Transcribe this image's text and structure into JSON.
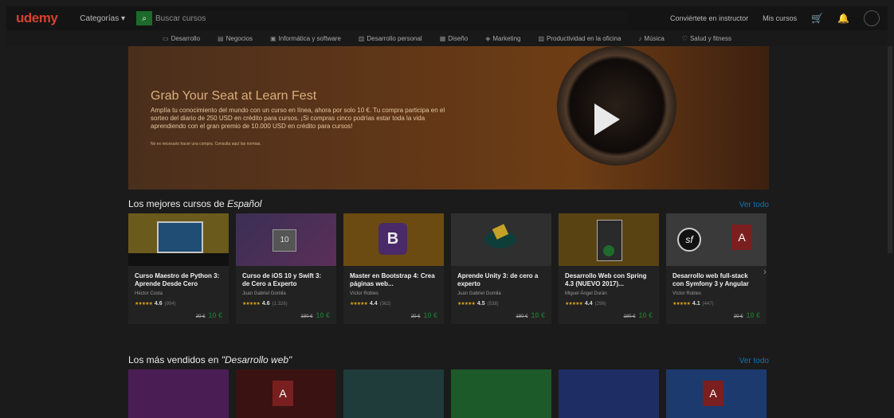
{
  "header": {
    "logo": "udemy",
    "categories_label": "Categorías ▾",
    "search_placeholder": "Buscar cursos",
    "links": [
      "Conviértete en instructor",
      "Mis cursos"
    ]
  },
  "nav": {
    "items": [
      {
        "label": "Desarrollo",
        "icon": "code-icon"
      },
      {
        "label": "Negocios",
        "icon": "briefcase-icon"
      },
      {
        "label": "Informática y software",
        "icon": "computer-icon"
      },
      {
        "label": "Desarrollo personal",
        "icon": "person-icon"
      },
      {
        "label": "Diseño",
        "icon": "pen-icon"
      },
      {
        "label": "Marketing",
        "icon": "megaphone-icon"
      },
      {
        "label": "Productividad en la oficina",
        "icon": "monitor-icon"
      },
      {
        "label": "Música",
        "icon": "music-icon"
      },
      {
        "label": "Salud y fitness",
        "icon": "heart-icon"
      }
    ]
  },
  "banner": {
    "title": "Grab Your Seat at Learn Fest",
    "text": "Amplía tu conocimiento del mundo con un curso en línea, ahora por solo 10 €. Tu compra participa en el sorteo del diario de 250 USD en crédito para cursos. ¡Si compras cinco podrías estar toda la vida aprendiendo con el gran premio de 10.000 USD en crédito para cursos!",
    "small": "No es necesario hacer una compra. Consulta aquí las normas."
  },
  "section1": {
    "title_prefix": "Los mejores cursos de",
    "title_topic": "Español",
    "see_all": "Ver todo",
    "cards": [
      {
        "title": "Curso Maestro de Python 3: Aprende Desde Cero",
        "author": "Héctor Costa",
        "rating": "4.6",
        "count": "(994)",
        "old_price": "20 €",
        "price": "10 €",
        "thumb_color": "#6a5a1c"
      },
      {
        "title": "Curso de iOS 10 y Swift 3: de Cero a Experto",
        "author": "Juan Gabriel Gomila",
        "rating": "4.6",
        "count": "(1.326)",
        "old_price": "180 €",
        "price": "10 €",
        "thumb_color": "#4a2f5a"
      },
      {
        "title": "Master en Bootstrap 4: Crea páginas web...",
        "author": "Víctor Robles",
        "rating": "4.4",
        "count": "(362)",
        "old_price": "20 €",
        "price": "10 €",
        "thumb_color": "#6b4b12"
      },
      {
        "title": "Aprende Unity 3: de cero a experto",
        "author": "Juan Gabriel Gomila",
        "rating": "4.5",
        "count": "(538)",
        "old_price": "180 €",
        "price": "10 €",
        "thumb_color": "#2f2f2f"
      },
      {
        "title": "Desarrollo Web con Spring 4.3 (NUEVO 2017)...",
        "author": "Miguel Ángel Durán",
        "rating": "4.4",
        "count": "(296)",
        "old_price": "180 €",
        "price": "10 €",
        "thumb_color": "#5a4312"
      },
      {
        "title": "Desarrollo web full-stack con Symfony 3 y Angular",
        "author": "Víctor Robles",
        "rating": "4.1",
        "count": "(447)",
        "old_price": "20 €",
        "price": "10 €",
        "thumb_color": "#3a3a3a"
      }
    ]
  },
  "section2": {
    "title_prefix": "Los más vendidos en",
    "title_topic": "\"Desarrollo web\"",
    "see_all": "Ver todo",
    "cards": [
      {
        "thumb_color": "#4a1e55"
      },
      {
        "thumb_color": "#3a1212"
      },
      {
        "thumb_color": "#1f3b3a"
      },
      {
        "thumb_color": "#1d5a2a"
      },
      {
        "thumb_color": "#1e2d64"
      },
      {
        "thumb_color": "#1d3a6e"
      }
    ]
  }
}
